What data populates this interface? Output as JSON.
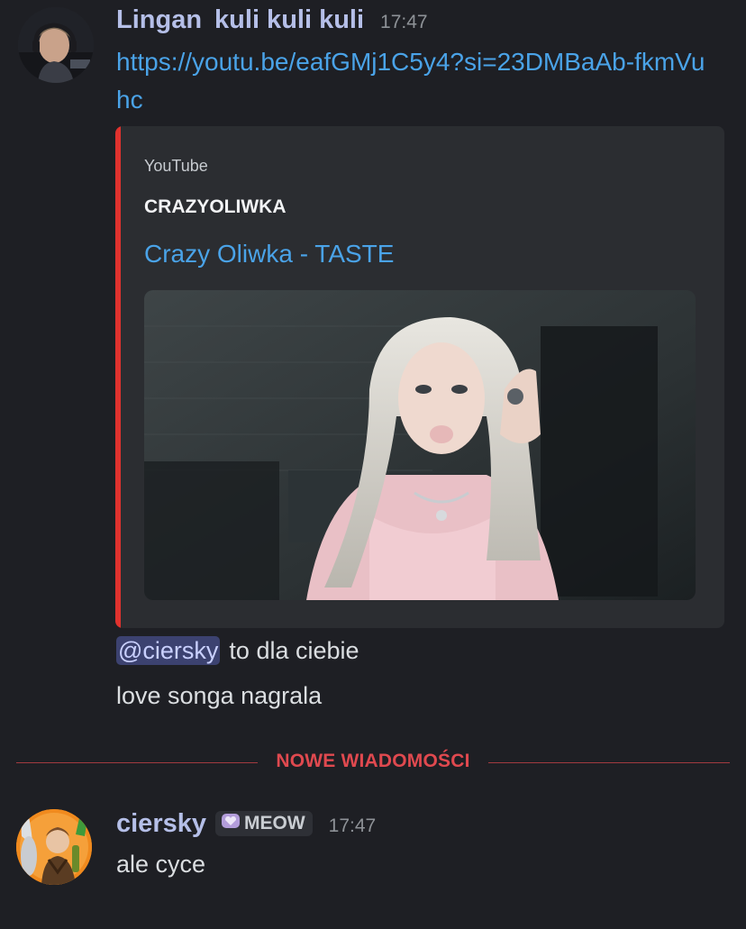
{
  "messages": [
    {
      "username": "Lingan",
      "display_extra": "kuli kuli kuli",
      "timestamp": "17:47",
      "link": "https://youtu.be/eafGMj1C5y4?si=23DMBaAb-fkmVuhc",
      "embed": {
        "provider": "YouTube",
        "author": "CRAZYOLIWKA",
        "title": "Crazy Oliwka - TASTE",
        "accent_color": "#e0322e"
      },
      "mention": "@ciersky",
      "line1_rest": "to dla ciebie",
      "line2": "love songa nagrala"
    },
    {
      "username": "ciersky",
      "role_tag": "MEOW",
      "role_icon": "purple-heart-icon",
      "timestamp": "17:47",
      "text": "ale cyce"
    }
  ],
  "divider": {
    "label": "NOWE WIADOMOŚCI",
    "color": "#e0494f"
  },
  "colors": {
    "background": "#1e1f24",
    "link": "#4aa3e8",
    "username": "#b5bfe8",
    "mention_bg": "#3c4270"
  }
}
